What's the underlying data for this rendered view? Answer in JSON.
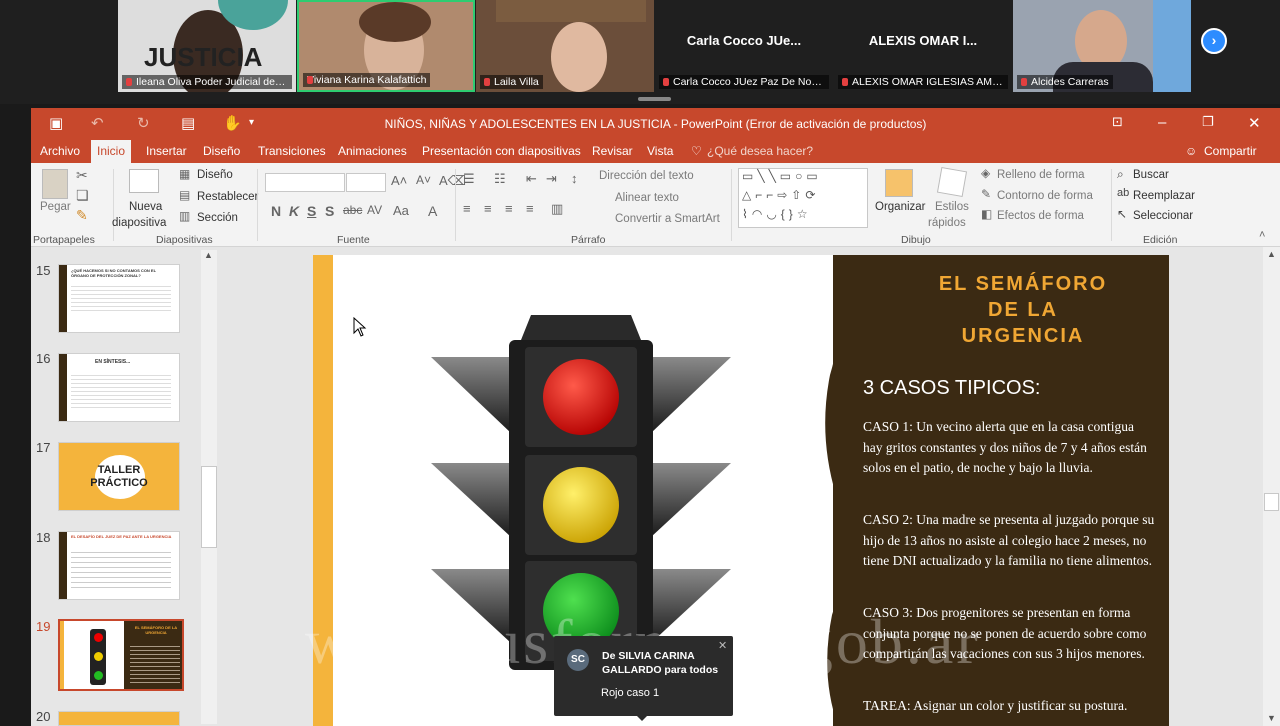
{
  "participants": [
    {
      "name": "Ileana Oliva Poder Judicial de C...",
      "banner": "JUSTICIA"
    },
    {
      "name": "Viviana Karina Kalafattich"
    },
    {
      "name": "Laila Villa"
    },
    {
      "big": "Carla Cocco JUe...",
      "name": "Carla Cocco JUez Paz De Noetin..."
    },
    {
      "big": "ALEXIS OMAR I...",
      "name": "ALEXIS OMAR IGLESIAS AMAYA"
    },
    {
      "name": "Alcides Carreras"
    }
  ],
  "window": {
    "title": "NIÑOS, NIÑAS Y ADOLESCENTES EN LA JUSTICIA - PowerPoint (Error de activación de productos)"
  },
  "tabs": [
    "Archivo",
    "Inicio",
    "Insertar",
    "Diseño",
    "Transiciones",
    "Animaciones",
    "Presentación con diapositivas",
    "Revisar",
    "Vista"
  ],
  "tellme": "¿Qué desea hacer?",
  "share": "Compartir",
  "ribbon": {
    "pegar": "Pegar",
    "nueva1": "Nueva",
    "nueva2": "diapositiva",
    "diseno": "Diseño",
    "restablecer": "Restablecer",
    "seccion": "Sección",
    "dirTexto": "Dirección del texto",
    "alinearTexto": "Alinear texto",
    "smartart": "Convertir a SmartArt",
    "organizar": "Organizar",
    "estilos1": "Estilos",
    "estilos2": "rápidos",
    "relleno": "Relleno de forma",
    "contorno": "Contorno de forma",
    "efectos": "Efectos de forma",
    "buscar": "Buscar",
    "reemplazar": "Reemplazar",
    "seleccionar": "Seleccionar",
    "groups": [
      "Portapapeles",
      "Diapositivas",
      "Fuente",
      "Párrafo",
      "Dibujo",
      "Edición"
    ]
  },
  "thumbs": [
    {
      "num": "15",
      "title": "¿QUÉ HACEMOS SI NO CONTAMOS CON EL ÓRGANO DE PROTECCIÓN ZONAL?"
    },
    {
      "num": "16",
      "title": "EN SÍNTESIS..."
    },
    {
      "num": "17",
      "title1": "TALLER",
      "title2": "PRÁCTICO"
    },
    {
      "num": "18",
      "title": "EL DESAFÍO DEL JUEZ DE PAZ ANTE LA URGENCIA"
    },
    {
      "num": "19",
      "title": "EL SEMÁFORO DE LA URGENCIA"
    },
    {
      "num": "20"
    }
  ],
  "slide": {
    "title1": "EL SEMÁFORO",
    "title2": "DE LA",
    "title3": "URGENCIA",
    "heading": "3 CASOS TIPICOS:",
    "caso1": "CASO 1: Un vecino alerta que en la casa contigua hay gritos constantes y dos niños de 7 y 4 años están solos en el patio, de noche y bajo la lluvia.",
    "caso2": "CASO 2:  Una madre se presenta al juzgado porque su hijo de 13 años no asiste al colegio hace 2 meses, no tiene DNI actualizado y la familia no tiene alimentos.",
    "caso3": "CASO 3:  Dos progenitores se presentan en forma conjunta porque no se ponen de acuerdo sobre como compartirán las vacaciones con sus 3 hijos menores.",
    "tarea": "TAREA: Asignar un color y justificar su  postura."
  },
  "watermark": "www.jusformosa.gob.ar",
  "chat": {
    "initials": "SC",
    "from": "De SILVIA CARINA GALLARDO para todos",
    "message": "Rojo caso 1"
  },
  "colors": {
    "accent": "#c7482c",
    "panel": "#3b2a13",
    "slideTitle": "#f0a734",
    "zoomBlue": "#2d8cff"
  }
}
